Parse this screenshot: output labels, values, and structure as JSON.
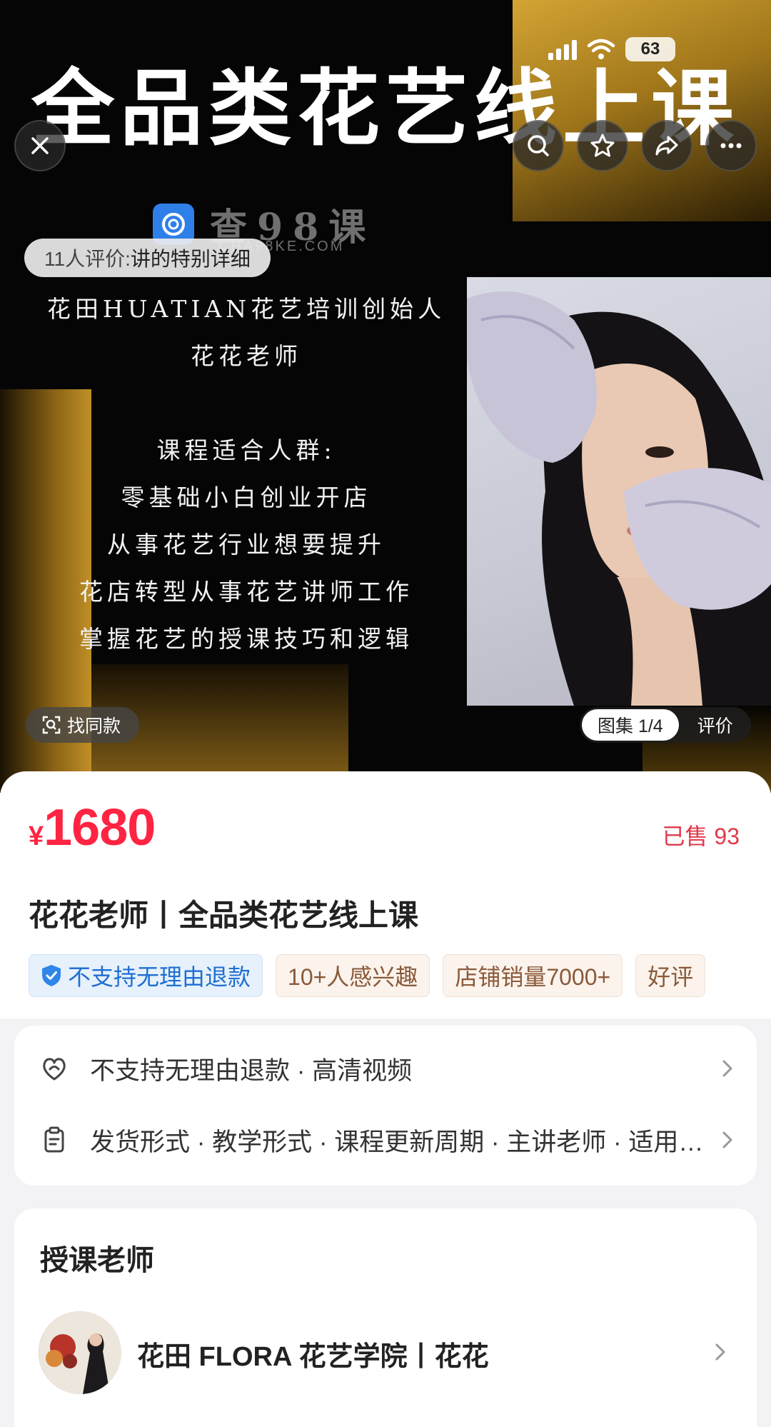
{
  "hero": {
    "title": "全品类花艺线上课",
    "status_battery": "63",
    "review_prefix": "11人评价:",
    "review_text": "讲的特别详细",
    "watermark_main": "查98课",
    "watermark_sub": "CHA98KE.COM",
    "poster_lines": [
      "花田HUATIAN花艺培训创始人",
      "花花老师",
      "",
      "课程适合人群:",
      "零基础小白创业开店",
      "从事花艺行业想要提升",
      "花店转型从事花艺讲师工作",
      "掌握花艺的授课技巧和逻辑"
    ],
    "find_same_label": "找同款",
    "gallery_label": "图集 1/4",
    "reviews_tab_label": "评价"
  },
  "product": {
    "currency": "¥",
    "price": "1680",
    "sold": "已售 93",
    "title": "花花老师丨全品类花艺线上课",
    "tags": [
      "不支持无理由退款",
      "10+人感兴趣",
      "店铺销量7000+",
      "好评"
    ]
  },
  "info": {
    "row1": "不支持无理由退款 · 高清视频",
    "row2": "发货形式 · 教学形式 · 课程更新周期 · 主讲老师 · 适用人群"
  },
  "teacher": {
    "heading": "授课老师",
    "name": "花田 FLORA 花艺学院丨花花"
  },
  "colors": {
    "price_red": "#ff2442",
    "gold": "#c99a2a",
    "tag_blue": "#1f6fd1",
    "tag_tan": "#8a5a3a"
  },
  "icons": [
    "close-icon",
    "search-icon",
    "star-icon",
    "share-icon",
    "more-icon",
    "scan-icon",
    "shield-check-icon",
    "refund-icon",
    "clipboard-icon",
    "chevron-right-icon"
  ]
}
